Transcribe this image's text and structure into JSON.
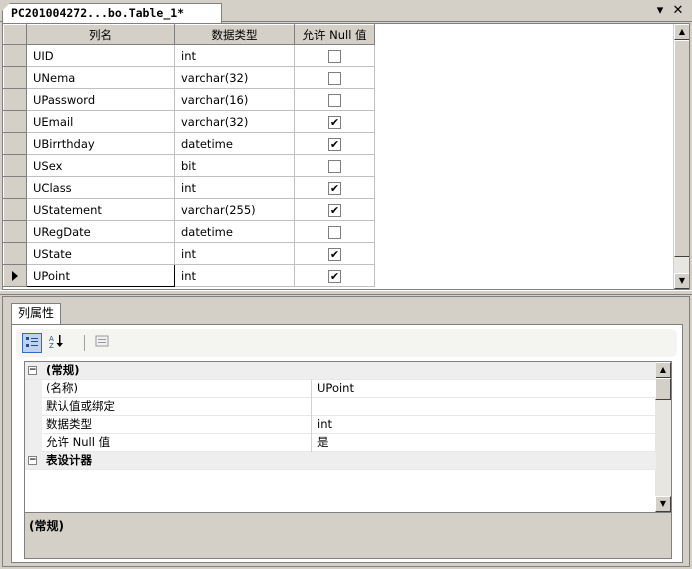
{
  "document_tab": {
    "title": "PC201004272...bo.Table_1*"
  },
  "tab_controls": {
    "dropdown": "▾",
    "close": "✕"
  },
  "grid": {
    "headers": [
      "列名",
      "数据类型",
      "允许 Null 值"
    ],
    "rows": [
      {
        "name": "UID",
        "type": "int",
        "nullable": false
      },
      {
        "name": "UNema",
        "type": "varchar(32)",
        "nullable": false
      },
      {
        "name": "UPassword",
        "type": "varchar(16)",
        "nullable": false
      },
      {
        "name": "UEmail",
        "type": "varchar(32)",
        "nullable": true
      },
      {
        "name": "UBirrthday",
        "type": "datetime",
        "nullable": true
      },
      {
        "name": "USex",
        "type": "bit",
        "nullable": false
      },
      {
        "name": "UClass",
        "type": "int",
        "nullable": true
      },
      {
        "name": "UStatement",
        "type": "varchar(255)",
        "nullable": true
      },
      {
        "name": "URegDate",
        "type": "datetime",
        "nullable": false
      },
      {
        "name": "UState",
        "type": "int",
        "nullable": true
      },
      {
        "name": "UPoint",
        "type": "int",
        "nullable": true,
        "current": true
      }
    ]
  },
  "properties_panel": {
    "tab_label": "列属性",
    "toolbar": {
      "categorized_icon": "categorized-icon",
      "alphabetical_icon": "sort-alphabetical-icon",
      "pages_icon": "property-pages-icon"
    },
    "categories": [
      {
        "label": "(常规)",
        "expander": "⊟",
        "items": [
          {
            "name": "(名称)",
            "value": "UPoint"
          },
          {
            "name": "默认值或绑定",
            "value": ""
          },
          {
            "name": "数据类型",
            "value": "int"
          },
          {
            "name": "允许 Null 值",
            "value": "是"
          }
        ]
      },
      {
        "label": "表设计器",
        "expander": "⊟",
        "items": []
      }
    ],
    "description_title": "(常规)"
  }
}
